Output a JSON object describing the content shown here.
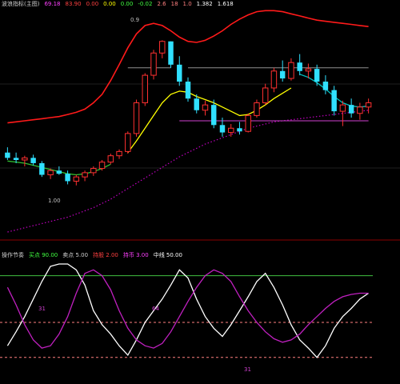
{
  "main_panel": {
    "header": {
      "title": "波浪指标(主图)",
      "items": [
        "69.18",
        "83.90",
        "0.00",
        "0.00",
        "0.00",
        "-0.02",
        "2.6",
        "18",
        "1.0",
        "1.382",
        "1.618"
      ],
      "item_colors": [
        "#ff40ff",
        "#ff4040",
        "#ff4040",
        "#ffff00",
        "#40ff40",
        "#40ff40",
        "#ff8080",
        "#ff8080",
        "#ff8080",
        "#ffffff",
        "#ffffff"
      ]
    },
    "price_label": "1.00",
    "peak_label": "0.9"
  },
  "sub_panel": {
    "header": {
      "title": "操作节奏",
      "items": [
        {
          "name": "买点",
          "value": "90.00",
          "color": "#40ff40"
        },
        {
          "name": "卖点",
          "value": "5.00",
          "color": "#cfcfcf"
        },
        {
          "name": "持股",
          "value": "2.00",
          "color": "#ff4040"
        },
        {
          "name": "持币",
          "value": "3.00",
          "color": "#ff40ff"
        },
        {
          "name": "中线",
          "value": "50.00",
          "color": "#ffffff"
        }
      ]
    },
    "labels": [
      "31",
      "64",
      "31"
    ]
  },
  "colors": {
    "background": "#000000",
    "up": "#ff3030",
    "down": "#30e0ff",
    "upper_band": "#ff1a1a",
    "grid_dot": "#c000c0",
    "sub_top_line": "#40c040",
    "sub_mid_line": "#ff8080",
    "k_line": "#ffffff",
    "d_line": "#c020c0"
  },
  "chart_data": [
    {
      "type": "candlestick",
      "title": "",
      "candles": [
        [
          99.5,
          100.0,
          98.8,
          99.0
        ],
        [
          99.0,
          99.5,
          98.5,
          98.8
        ],
        [
          98.8,
          99.2,
          98.2,
          99.0
        ],
        [
          99.0,
          99.3,
          98.3,
          98.5
        ],
        [
          98.5,
          98.7,
          97.2,
          97.4
        ],
        [
          97.4,
          98.0,
          97.0,
          97.8
        ],
        [
          97.8,
          98.2,
          97.4,
          97.5
        ],
        [
          97.5,
          97.8,
          96.5,
          96.8
        ],
        [
          96.8,
          97.4,
          96.4,
          97.2
        ],
        [
          97.2,
          97.8,
          96.8,
          97.6
        ],
        [
          97.6,
          98.2,
          97.3,
          98.0
        ],
        [
          98.0,
          98.8,
          97.8,
          98.6
        ],
        [
          98.6,
          99.4,
          98.4,
          99.2
        ],
        [
          99.2,
          99.8,
          98.9,
          99.6
        ],
        [
          99.6,
          101.5,
          99.4,
          101.3
        ],
        [
          101.3,
          104.5,
          101.0,
          104.2
        ],
        [
          104.2,
          107.0,
          103.9,
          106.8
        ],
        [
          106.8,
          109.2,
          106.4,
          108.9
        ],
        [
          108.9,
          110.1,
          108.4,
          110.0
        ],
        [
          110.0,
          110.0,
          107.5,
          107.8
        ],
        [
          107.8,
          108.6,
          105.8,
          106.2
        ],
        [
          106.2,
          106.6,
          104.3,
          104.6
        ],
        [
          104.6,
          105.0,
          103.2,
          103.5
        ],
        [
          103.5,
          104.4,
          103.0,
          104.0
        ],
        [
          104.0,
          104.5,
          101.8,
          102.1
        ],
        [
          102.1,
          102.8,
          101.0,
          101.4
        ],
        [
          101.4,
          102.2,
          101.0,
          101.8
        ],
        [
          101.8,
          102.4,
          101.2,
          101.5
        ],
        [
          101.5,
          103.2,
          101.4,
          103.0
        ],
        [
          103.0,
          104.5,
          102.8,
          104.2
        ],
        [
          104.2,
          106.0,
          104.0,
          105.6
        ],
        [
          105.6,
          107.5,
          105.2,
          107.2
        ],
        [
          107.2,
          108.2,
          106.2,
          106.5
        ],
        [
          106.5,
          108.4,
          106.3,
          108.0
        ],
        [
          108.0,
          108.8,
          106.8,
          107.2
        ],
        [
          107.2,
          107.9,
          106.5,
          107.4
        ],
        [
          107.4,
          107.8,
          105.8,
          106.2
        ],
        [
          106.2,
          106.8,
          105.0,
          105.4
        ],
        [
          105.4,
          105.8,
          103.0,
          103.4
        ],
        [
          103.4,
          104.4,
          102.0,
          104.0
        ],
        [
          104.0,
          104.6,
          102.8,
          103.2
        ],
        [
          103.2,
          104.2,
          102.6,
          103.8
        ],
        [
          103.8,
          104.6,
          103.2,
          104.2
        ]
      ],
      "ma_series": [
        {
          "color": "#ffff00",
          "values": [
            null,
            null,
            null,
            null,
            null,
            null,
            null,
            null,
            null,
            null,
            null,
            null,
            null,
            null,
            99.5,
            100.6,
            101.8,
            103.0,
            104.2,
            105.0,
            105.3,
            105.2,
            104.8,
            104.5,
            104.2,
            103.8,
            103.4,
            103.0,
            103.1,
            103.5,
            104.0,
            104.6,
            105.1,
            105.6,
            null,
            null,
            null,
            null,
            null,
            null,
            null,
            null,
            null
          ]
        },
        {
          "color": "#00c0c0",
          "values": [
            null,
            null,
            null,
            null,
            null,
            null,
            null,
            null,
            null,
            null,
            null,
            null,
            null,
            null,
            null,
            null,
            null,
            null,
            null,
            null,
            null,
            null,
            null,
            null,
            null,
            null,
            null,
            null,
            null,
            null,
            null,
            null,
            null,
            null,
            106.9,
            106.6,
            106.1,
            105.5,
            104.8,
            104.2,
            103.9,
            103.8,
            103.9
          ]
        },
        {
          "color": "#30c030",
          "values": [
            98.7,
            98.6,
            98.5,
            98.3,
            98.1,
            97.9,
            97.7,
            97.5,
            97.4,
            97.5,
            97.7,
            98.0,
            98.4,
            null,
            null,
            null,
            null,
            null,
            null,
            null,
            null,
            null,
            null,
            null,
            null,
            null,
            null,
            null,
            null,
            null,
            null,
            null,
            null,
            null,
            null,
            null,
            null,
            null,
            null,
            null,
            null,
            null,
            null
          ]
        }
      ],
      "upper_band": [
        102.3,
        102.4,
        102.5,
        102.6,
        102.7,
        102.8,
        102.9,
        103.1,
        103.3,
        103.6,
        104.2,
        105.0,
        106.3,
        107.8,
        109.4,
        110.7,
        111.5,
        111.7,
        111.5,
        111.0,
        110.4,
        110.0,
        109.9,
        110.1,
        110.5,
        111.0,
        111.6,
        112.1,
        112.5,
        112.8,
        112.9,
        112.9,
        112.8,
        112.6,
        112.4,
        112.2,
        112.0,
        111.9,
        111.8,
        111.7,
        111.6,
        111.5,
        111.4
      ],
      "lower_band": [
        92.0,
        92.2,
        92.4,
        92.6,
        92.8,
        93.0,
        93.2,
        93.4,
        93.7,
        94.0,
        94.3,
        94.7,
        95.1,
        95.6,
        96.1,
        96.6,
        97.1,
        97.6,
        98.1,
        98.6,
        99.1,
        99.5,
        99.9,
        100.3,
        100.6,
        100.9,
        101.2,
        101.5,
        101.8,
        102.0,
        102.2,
        102.4,
        102.5,
        102.6,
        102.7,
        102.8,
        102.9,
        103.0,
        103.1,
        103.2,
        103.3,
        103.4,
        103.5
      ],
      "horizontal_levels": [
        {
          "y": 107.5,
          "from": 14,
          "to": 19,
          "color": "#909090"
        },
        {
          "y": 107.5,
          "from": 21,
          "to": 42,
          "color": "#909090"
        },
        {
          "y": 102.5,
          "from": 20,
          "to": 42,
          "color": "#d040d0"
        }
      ]
    },
    {
      "type": "line",
      "title": "",
      "ylim": [
        0,
        100
      ],
      "series": [
        {
          "values": [
            30,
            42,
            55,
            70,
            85,
            98,
            100,
            100,
            95,
            82,
            60,
            48,
            40,
            30,
            22,
            35,
            50,
            60,
            70,
            82,
            95,
            88,
            70,
            55,
            45,
            38,
            48,
            60,
            72,
            85,
            92,
            80,
            65,
            48,
            35,
            28,
            20,
            30,
            45,
            55,
            62,
            70,
            75
          ]
        },
        {
          "values": [
            80,
            65,
            48,
            35,
            28,
            30,
            40,
            55,
            75,
            92,
            95,
            90,
            78,
            60,
            45,
            35,
            30,
            28,
            32,
            42,
            55,
            68,
            80,
            90,
            95,
            92,
            85,
            72,
            60,
            50,
            42,
            36,
            33,
            35,
            40,
            48,
            55,
            62,
            68,
            72,
            74,
            75,
            75
          ]
        }
      ],
      "levels": [
        90,
        50,
        20
      ]
    }
  ]
}
